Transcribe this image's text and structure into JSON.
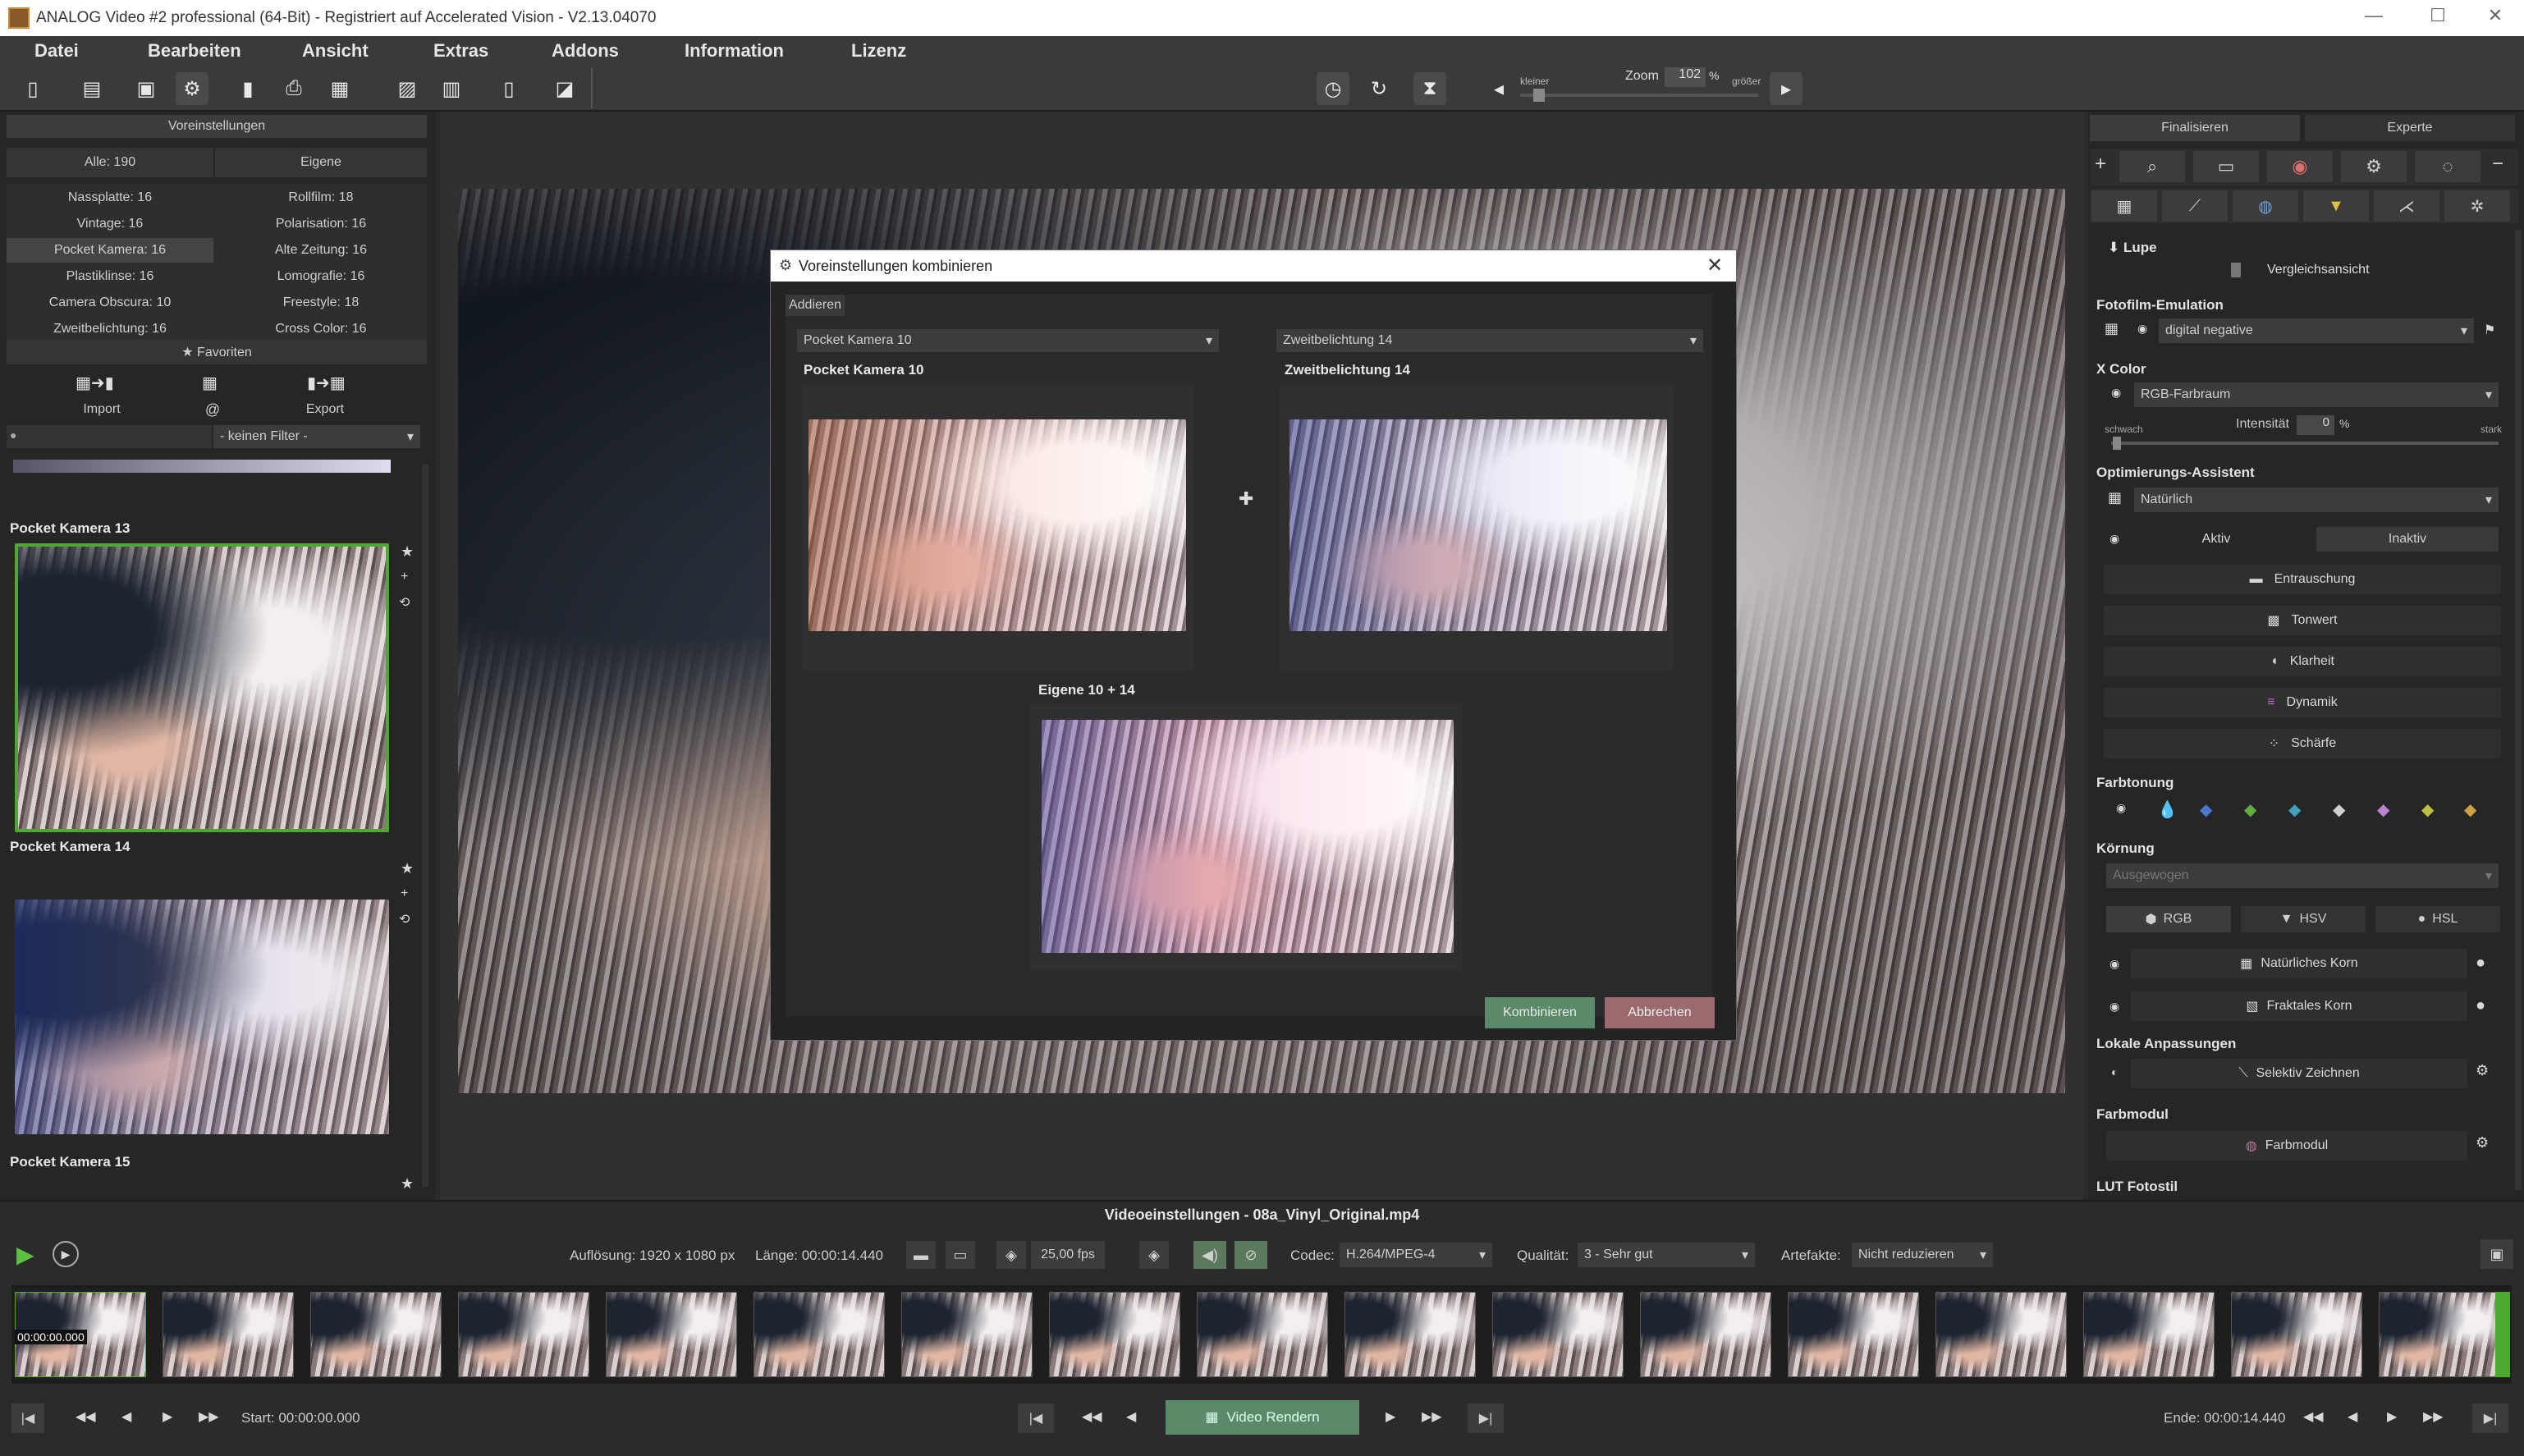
{
  "window": {
    "title": "ANALOG Video #2 professional (64-Bit) - Registriert auf Accelerated Vision - V2.13.04070",
    "min": "—",
    "max": "☐",
    "close": "✕"
  },
  "menu": [
    "Datei",
    "Bearbeiten",
    "Ansicht",
    "Extras",
    "Addons",
    "Information",
    "Lizenz"
  ],
  "toolbar": {
    "zoom_small": "kleiner",
    "zoom_label": "Zoom",
    "zoom_value": "102",
    "zoom_unit": "%",
    "zoom_large": "größer"
  },
  "left": {
    "header": "Voreinstellungen",
    "all": "Alle: 190",
    "own": "Eigene",
    "categories": [
      [
        "Nassplatte: 16",
        "Rollfilm: 18"
      ],
      [
        "Vintage: 16",
        "Polarisation: 16"
      ],
      [
        "Pocket Kamera: 16",
        "Alte Zeitung: 16"
      ],
      [
        "Plastiklinse: 16",
        "Lomografie: 16"
      ],
      [
        "Camera Obscura: 10",
        "Freestyle: 18"
      ],
      [
        "Zweitbelichtung: 16",
        "Cross Color: 16"
      ]
    ],
    "favorites": "★ Favoriten",
    "import": "Import",
    "at": "@",
    "export": "Export",
    "filter": "- keinen Filter -",
    "presets": [
      "Pocket Kamera 13",
      "Pocket Kamera 14",
      "Pocket Kamera 15"
    ]
  },
  "dialog": {
    "title": "Voreinstellungen kombinieren",
    "add": "Addieren",
    "left_select": "Pocket Kamera 10",
    "right_select": "Zweitbelichtung 14",
    "left_label": "Pocket Kamera 10",
    "right_label": "Zweitbelichtung 14",
    "plus": "✚",
    "result_label": "Eigene 10 + 14",
    "combine": "Kombinieren",
    "cancel": "Abbrechen",
    "close": "✕"
  },
  "right": {
    "tab_final": "Finalisieren",
    "tab_expert": "Experte",
    "lupe": "⬇ Lupe",
    "compare": "Vergleichsansicht",
    "fotofilm": "Fotofilm-Emulation",
    "fotofilm_value": "digital negative",
    "xcolor": "X Color",
    "xcolor_value": "RGB-Farbraum",
    "weak": "schwach",
    "intensity": "Intensität",
    "intensity_value": "0",
    "intensity_unit": "%",
    "strong": "stark",
    "optim": "Optimierungs-Assistent",
    "optim_value": "Natürlich",
    "active": "Aktiv",
    "inactive": "Inaktiv",
    "tools": [
      "Entrauschung",
      "Tonwert",
      "Klarheit",
      "Dynamik",
      "Schärfe"
    ],
    "farbtonung": "Farbtonung",
    "koernung": "Körnung",
    "koernung_value": "Ausgewogen",
    "rgb": "RGB",
    "hsv": "HSV",
    "hsl": "HSL",
    "natural_grain": "Natürliches Korn",
    "fractal_grain": "Fraktales Korn",
    "local": "Lokale Anpassungen",
    "selective": "Selektiv Zeichnen",
    "color_module": "Farbmodul",
    "color_module_btn": "Farbmodul",
    "lut": "LUT Fotostil"
  },
  "video": {
    "title": "Videoeinstellungen - 08a_Vinyl_Original.mp4",
    "resolution": "Auflösung: 1920 x 1080 px",
    "length": "Länge: 00:00:14.440",
    "fps": "25,00 fps",
    "codec_label": "Codec:",
    "codec": "H.264/MPEG-4",
    "quality_label": "Qualität:",
    "quality": "3 - Sehr gut",
    "artifacts_label": "Artefakte:",
    "artifacts": "Nicht reduzieren",
    "timecode": "00:00:00.000",
    "start": "Start: 00:00:00.000",
    "render": "Video Rendern",
    "end": "Ende: 00:00:14.440"
  },
  "colors": {
    "accent_green": "#5aa83a",
    "combine_btn": "#5a8a6a",
    "cancel_btn": "#9a6a6e"
  }
}
